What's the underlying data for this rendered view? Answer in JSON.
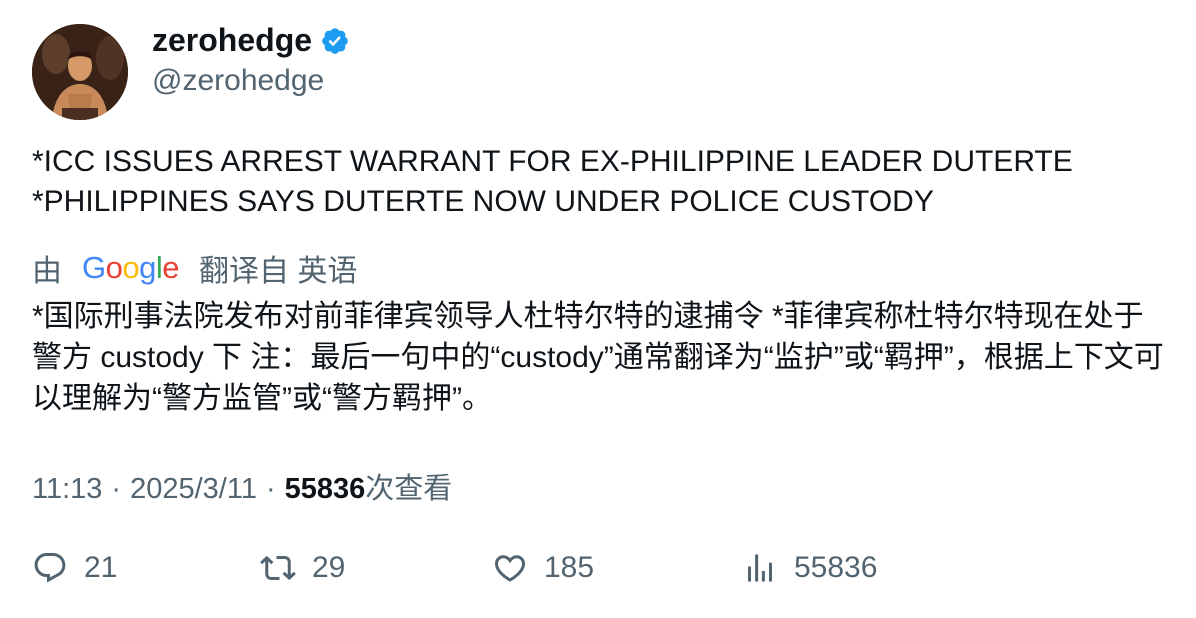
{
  "author": {
    "display_name": "zerohedge",
    "handle": "@zerohedge",
    "verified": true,
    "verified_color": "#1d9bf0"
  },
  "tweet": {
    "lines": [
      "*ICC ISSUES ARREST WARRANT FOR EX-PHILIPPINE LEADER DUTERTE",
      "*PHILIPPINES SAYS DUTERTE NOW UNDER POLICE CUSTODY"
    ]
  },
  "translation": {
    "prefix": "由",
    "provider": "Google",
    "suffix": "翻译自 英语",
    "text": "*国际刑事法院发布对前菲律宾领导人杜特尔特的逮捕令 *菲律宾称杜特尔特现在处于警方 custody 下 注：最后一句中的“custody”通常翻译为“监护”或“羁押”，根据上下文可以理解为“警方监管”或“警方羁押”。"
  },
  "meta": {
    "time": "11:13",
    "date": "2025/3/11",
    "views_count": "55836",
    "views_label": "次查看"
  },
  "actions": {
    "replies": "21",
    "retweets": "29",
    "likes": "185",
    "views": "55836"
  }
}
